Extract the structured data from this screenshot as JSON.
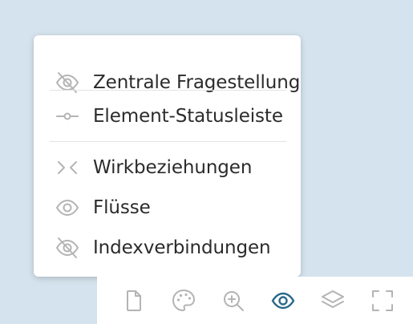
{
  "menu": {
    "items": [
      {
        "label": "Zentrale Fragestellung",
        "icon": "eye-off-icon"
      },
      {
        "label": "Element-Statusleiste",
        "icon": "status-bar-icon"
      },
      {
        "label": "Wirkbeziehungen",
        "icon": "chevrons-inward-icon"
      },
      {
        "label": "Flüsse",
        "icon": "eye-icon"
      },
      {
        "label": "Indexverbindungen",
        "icon": "eye-off-icon"
      }
    ]
  },
  "toolbar": {
    "tools": [
      {
        "icon": "document-icon",
        "active": false
      },
      {
        "icon": "palette-icon",
        "active": false
      },
      {
        "icon": "zoom-in-icon",
        "active": false
      },
      {
        "icon": "eye-icon",
        "active": true
      },
      {
        "icon": "layers-icon",
        "active": false
      },
      {
        "icon": "fullscreen-icon",
        "active": false
      }
    ]
  },
  "colors": {
    "background": "#d5e3ee",
    "icon_gray": "#b4b4b4",
    "active_blue": "#2b6a8a",
    "text": "#2b2b2b"
  }
}
